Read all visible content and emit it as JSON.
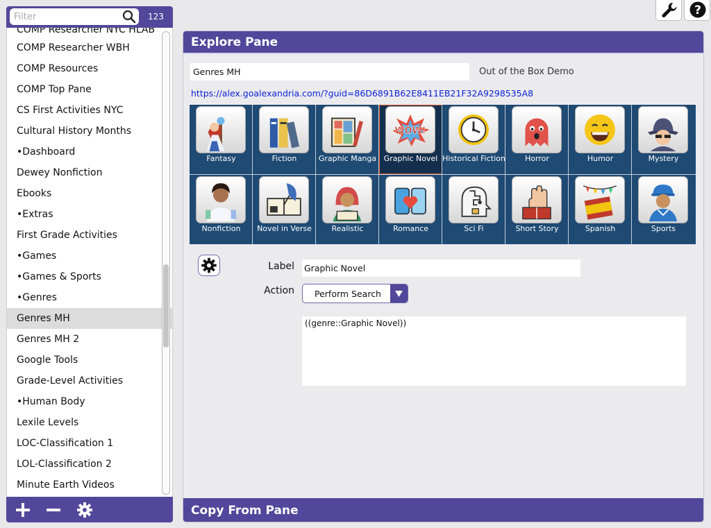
{
  "sidebar": {
    "filter_placeholder": "Filter",
    "count": "123",
    "partial_top_item": "COMP Researcher NYC HLAB",
    "items": [
      {
        "label": "COMP Researcher WBH",
        "selected": false
      },
      {
        "label": "COMP Resources",
        "selected": false
      },
      {
        "label": "COMP Top Pane",
        "selected": false
      },
      {
        "label": "CS First Activities NYC",
        "selected": false
      },
      {
        "label": "Cultural History Months",
        "selected": false
      },
      {
        "label": "•Dashboard",
        "selected": false
      },
      {
        "label": "Dewey Nonfiction",
        "selected": false
      },
      {
        "label": "Ebooks",
        "selected": false
      },
      {
        "label": "•Extras",
        "selected": false
      },
      {
        "label": "First Grade Activities",
        "selected": false
      },
      {
        "label": "•Games",
        "selected": false
      },
      {
        "label": "•Games & Sports",
        "selected": false
      },
      {
        "label": "•Genres",
        "selected": false
      },
      {
        "label": "Genres MH",
        "selected": true
      },
      {
        "label": "Genres MH 2",
        "selected": false
      },
      {
        "label": "Google Tools",
        "selected": false
      },
      {
        "label": "Grade-Level Activities",
        "selected": false
      },
      {
        "label": "•Human Body",
        "selected": false
      },
      {
        "label": "Lexile Levels",
        "selected": false
      },
      {
        "label": "LOC-Classification 1",
        "selected": false
      },
      {
        "label": "LOL-Classification 2",
        "selected": false
      },
      {
        "label": "Minute Earth Videos",
        "selected": false
      }
    ],
    "footer_icons": [
      "plus-icon",
      "minus-icon",
      "gear-icon"
    ]
  },
  "toolbar": {
    "icons": [
      "wrench-icon",
      "help-icon"
    ]
  },
  "explore_pane": {
    "title": "Explore Pane",
    "pane_name": "Genres MH",
    "demo_label": "Out of the Box Demo",
    "url": "https://alex.goalexandria.com/?guid=86D6891B62E8411EB21F32A9298535A8",
    "tiles": [
      {
        "label": "Fantasy",
        "icon": "fantasy-wizard-icon",
        "selected": false
      },
      {
        "label": "Fiction",
        "icon": "books-icon",
        "selected": false
      },
      {
        "label": "Graphic Manga",
        "icon": "manga-book-icon",
        "selected": false
      },
      {
        "label": "Graphic Novel",
        "icon": "wow-comic-icon",
        "selected": true
      },
      {
        "label": "Historical Fiction",
        "icon": "clock-icon",
        "selected": false
      },
      {
        "label": "Horror",
        "icon": "ghost-icon",
        "selected": false
      },
      {
        "label": "Humor",
        "icon": "laughing-face-icon",
        "selected": false
      },
      {
        "label": "Mystery",
        "icon": "detective-icon",
        "selected": false
      },
      {
        "label": "Nonfiction",
        "icon": "scientist-icon",
        "selected": false
      },
      {
        "label": "Novel in Verse",
        "icon": "quill-book-icon",
        "selected": false
      },
      {
        "label": "Realistic",
        "icon": "reading-girl-icon",
        "selected": false
      },
      {
        "label": "Romance",
        "icon": "phones-heart-icon",
        "selected": false
      },
      {
        "label": "Sci Fi",
        "icon": "robot-head-icon",
        "selected": false
      },
      {
        "label": "Short Story",
        "icon": "hand-book-icon",
        "selected": false
      },
      {
        "label": "Spanish",
        "icon": "spain-flag-icon",
        "selected": false
      },
      {
        "label": "Sports",
        "icon": "athlete-icon",
        "selected": false
      }
    ],
    "detail": {
      "label_caption": "Label",
      "label_value": "Graphic Novel",
      "action_caption": "Action",
      "action_value": "Perform Search",
      "query": "((genre::Graphic Novel))"
    }
  },
  "copy_pane": {
    "title": "Copy From Pane"
  },
  "colors": {
    "accent": "#52479a",
    "tile_background": "#1e4a74",
    "selected_tile_border": "#d9532a",
    "link": "#0b1fd4"
  }
}
